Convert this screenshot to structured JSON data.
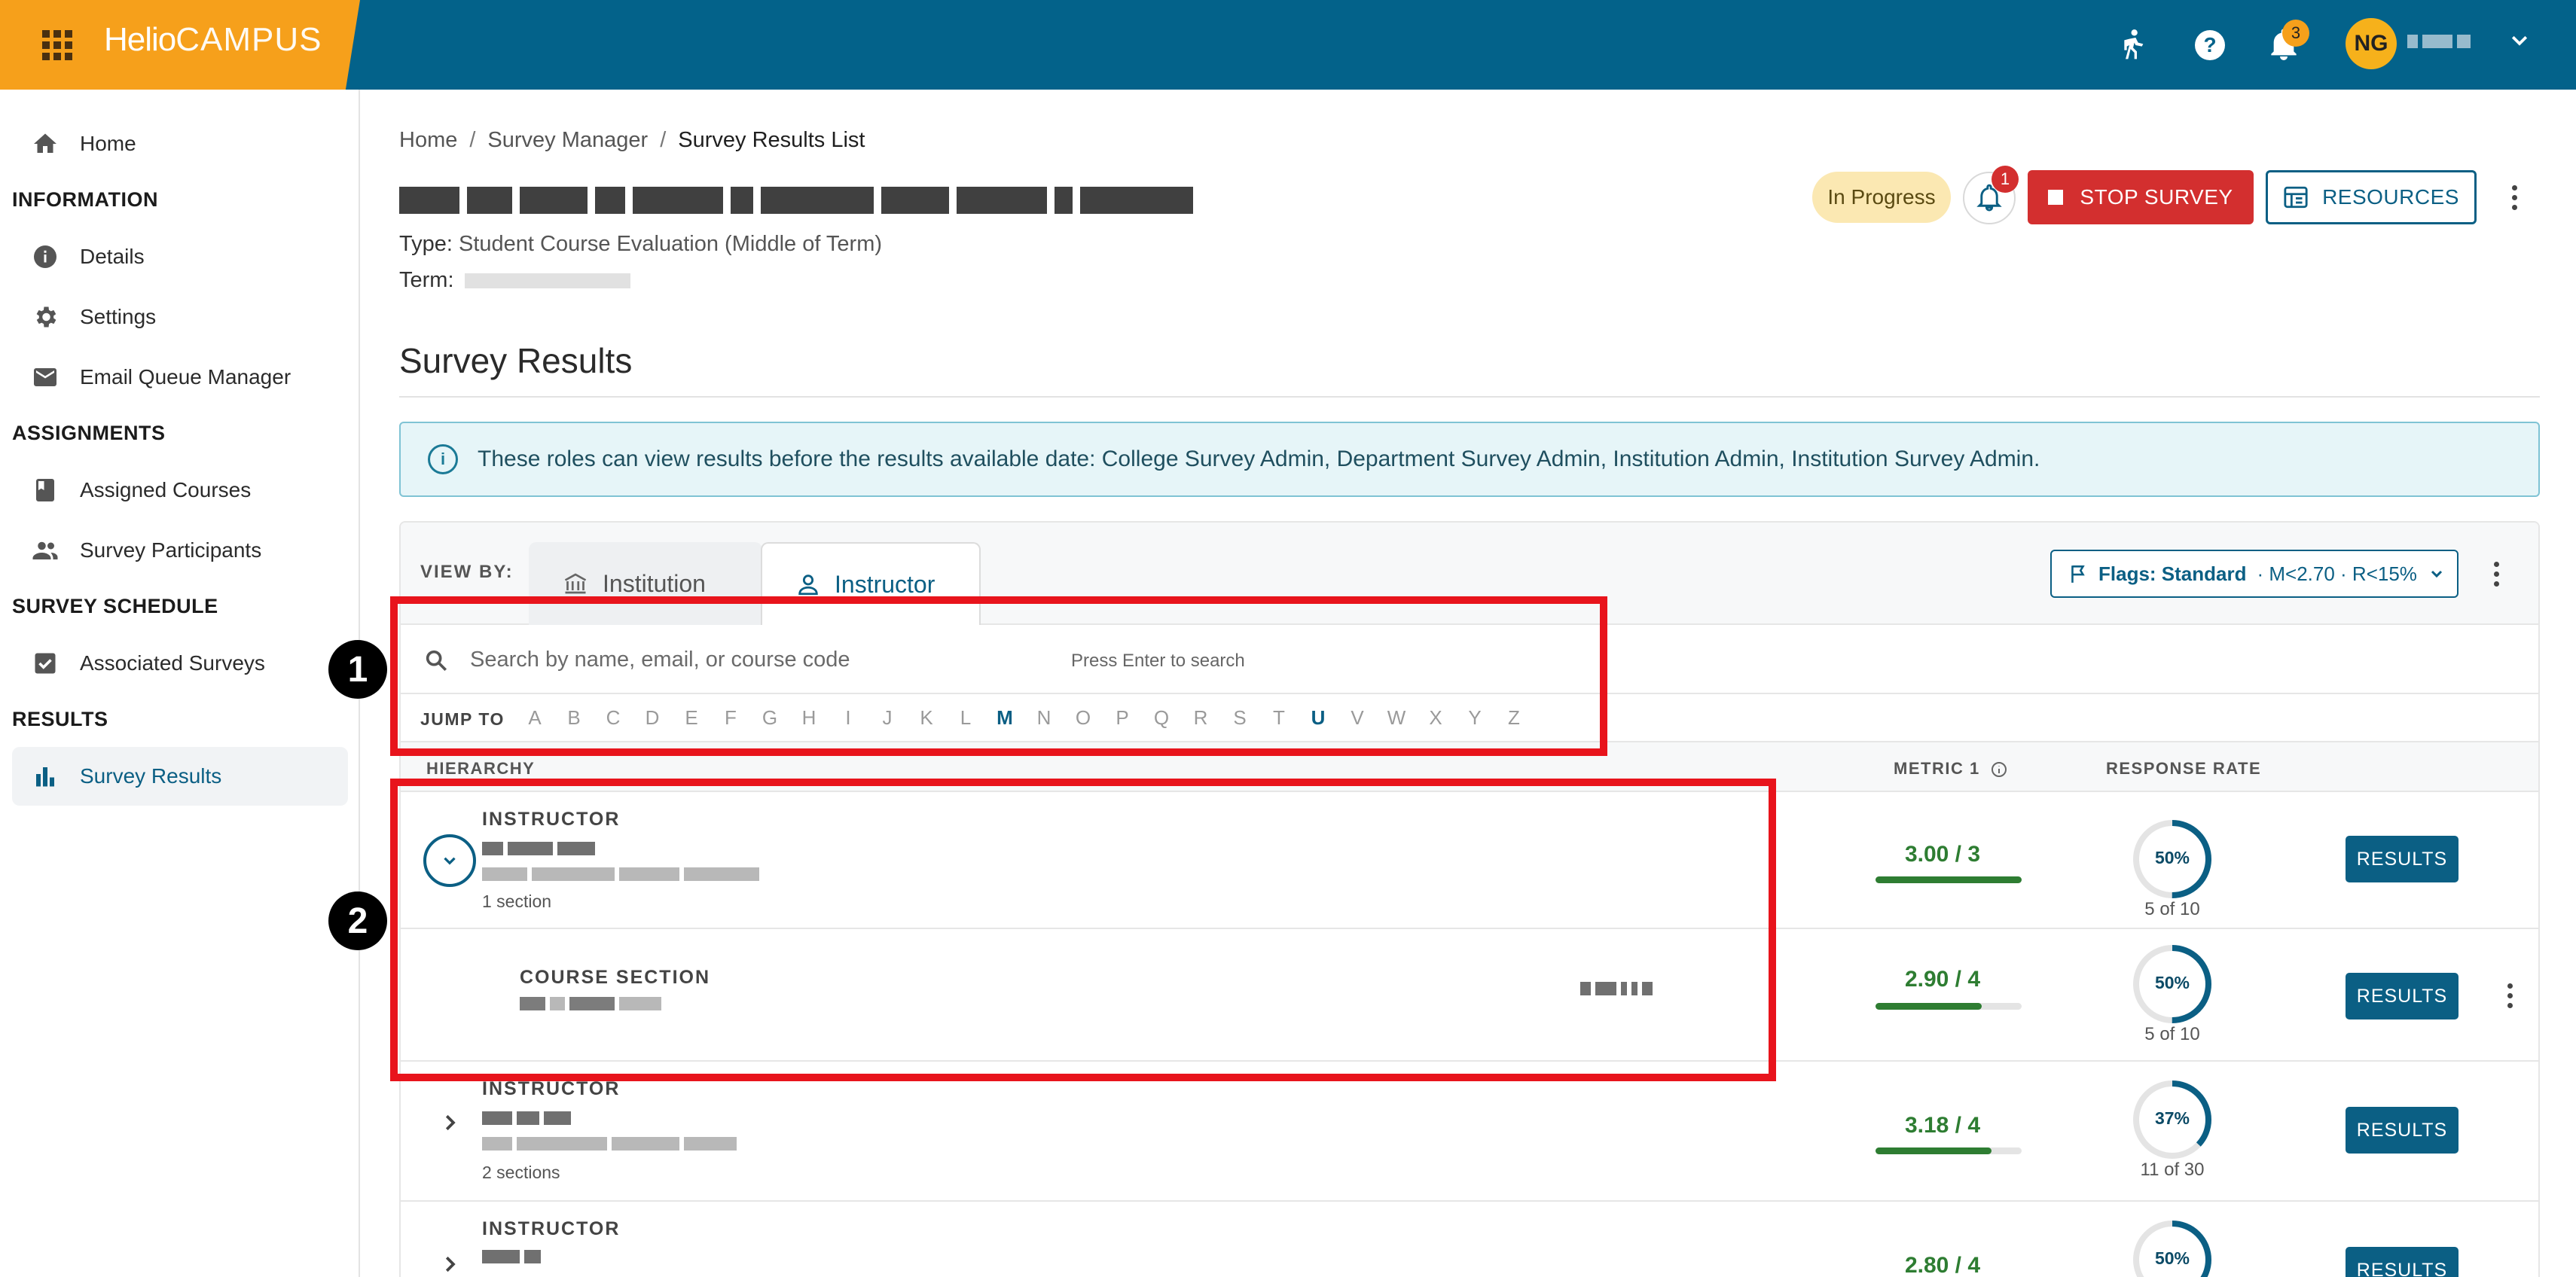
{
  "brand": {
    "name_part1": "Helio",
    "name_part2": "CAMPUS"
  },
  "topbar": {
    "notification_count": "3",
    "avatar_initials": "NG"
  },
  "sidebar": {
    "home": "Home",
    "sections": [
      {
        "heading": "INFORMATION",
        "items": [
          "Details",
          "Settings",
          "Email Queue Manager"
        ]
      },
      {
        "heading": "ASSIGNMENTS",
        "items": [
          "Assigned Courses",
          "Survey Participants"
        ]
      },
      {
        "heading": "SURVEY SCHEDULE",
        "items": [
          "Associated Surveys"
        ]
      },
      {
        "heading": "RESULTS",
        "items": [
          "Survey Results"
        ]
      }
    ]
  },
  "breadcrumb": {
    "home": "Home",
    "manager": "Survey Manager",
    "current": "Survey Results List"
  },
  "survey": {
    "type_label": "Type:",
    "type_value": "Student Course Evaluation (Middle of Term)",
    "term_label": "Term:",
    "status": "In Progress",
    "bell_count": "1",
    "stop_label": "STOP SURVEY",
    "resources_label": "RESOURCES"
  },
  "results": {
    "title": "Survey Results",
    "info": "These roles can view results before the results available date: College Survey Admin, Department Survey Admin, Institution Admin, Institution Survey Admin.",
    "view_by_label": "VIEW BY:",
    "tabs": [
      "Institution",
      "Instructor"
    ],
    "flags_label": "Flags: Standard",
    "flags_detail": "· M<2.70 · R<15%",
    "search_placeholder": "Search by name, email, or course code",
    "search_hint": "Press Enter to search",
    "jump_label": "JUMP TO",
    "letters": [
      "A",
      "B",
      "C",
      "D",
      "E",
      "F",
      "G",
      "H",
      "I",
      "J",
      "K",
      "L",
      "M",
      "N",
      "O",
      "P",
      "Q",
      "R",
      "S",
      "T",
      "U",
      "V",
      "W",
      "X",
      "Y",
      "Z"
    ],
    "active_letters": [
      "M",
      "U"
    ],
    "columns": {
      "hierarchy": "HIERARCHY",
      "metric": "METRIC 1",
      "response": "RESPONSE RATE"
    },
    "results_btn": "RESULTS",
    "rows": [
      {
        "kind": "INSTRUCTOR",
        "sub": "1 section",
        "metric": "3.00 / 3",
        "metric_fraction": 1.0,
        "rate": "50%",
        "rate_fraction": 0.5,
        "count": "5 of 10"
      },
      {
        "kind": "COURSE SECTION",
        "sub": "",
        "metric": "2.90 / 4",
        "metric_fraction": 0.725,
        "rate": "50%",
        "rate_fraction": 0.5,
        "count": "5 of 10"
      },
      {
        "kind": "INSTRUCTOR",
        "sub": "2 sections",
        "metric": "3.18 / 4",
        "metric_fraction": 0.795,
        "rate": "37%",
        "rate_fraction": 0.37,
        "count": "11 of 30"
      },
      {
        "kind": "INSTRUCTOR",
        "sub": "",
        "metric": "2.80 / 4",
        "metric_fraction": 0.7,
        "rate": "50%",
        "rate_fraction": 0.5,
        "count": ""
      }
    ]
  },
  "annotations": {
    "one": "1",
    "two": "2"
  },
  "colors": {
    "brand_orange": "#f6a01b",
    "topbar_blue": "#03628a",
    "accent": "#0b5f84",
    "stop_red": "#d32f2f",
    "metric_green": "#2e7d32",
    "annotation_red": "#e8141c"
  }
}
